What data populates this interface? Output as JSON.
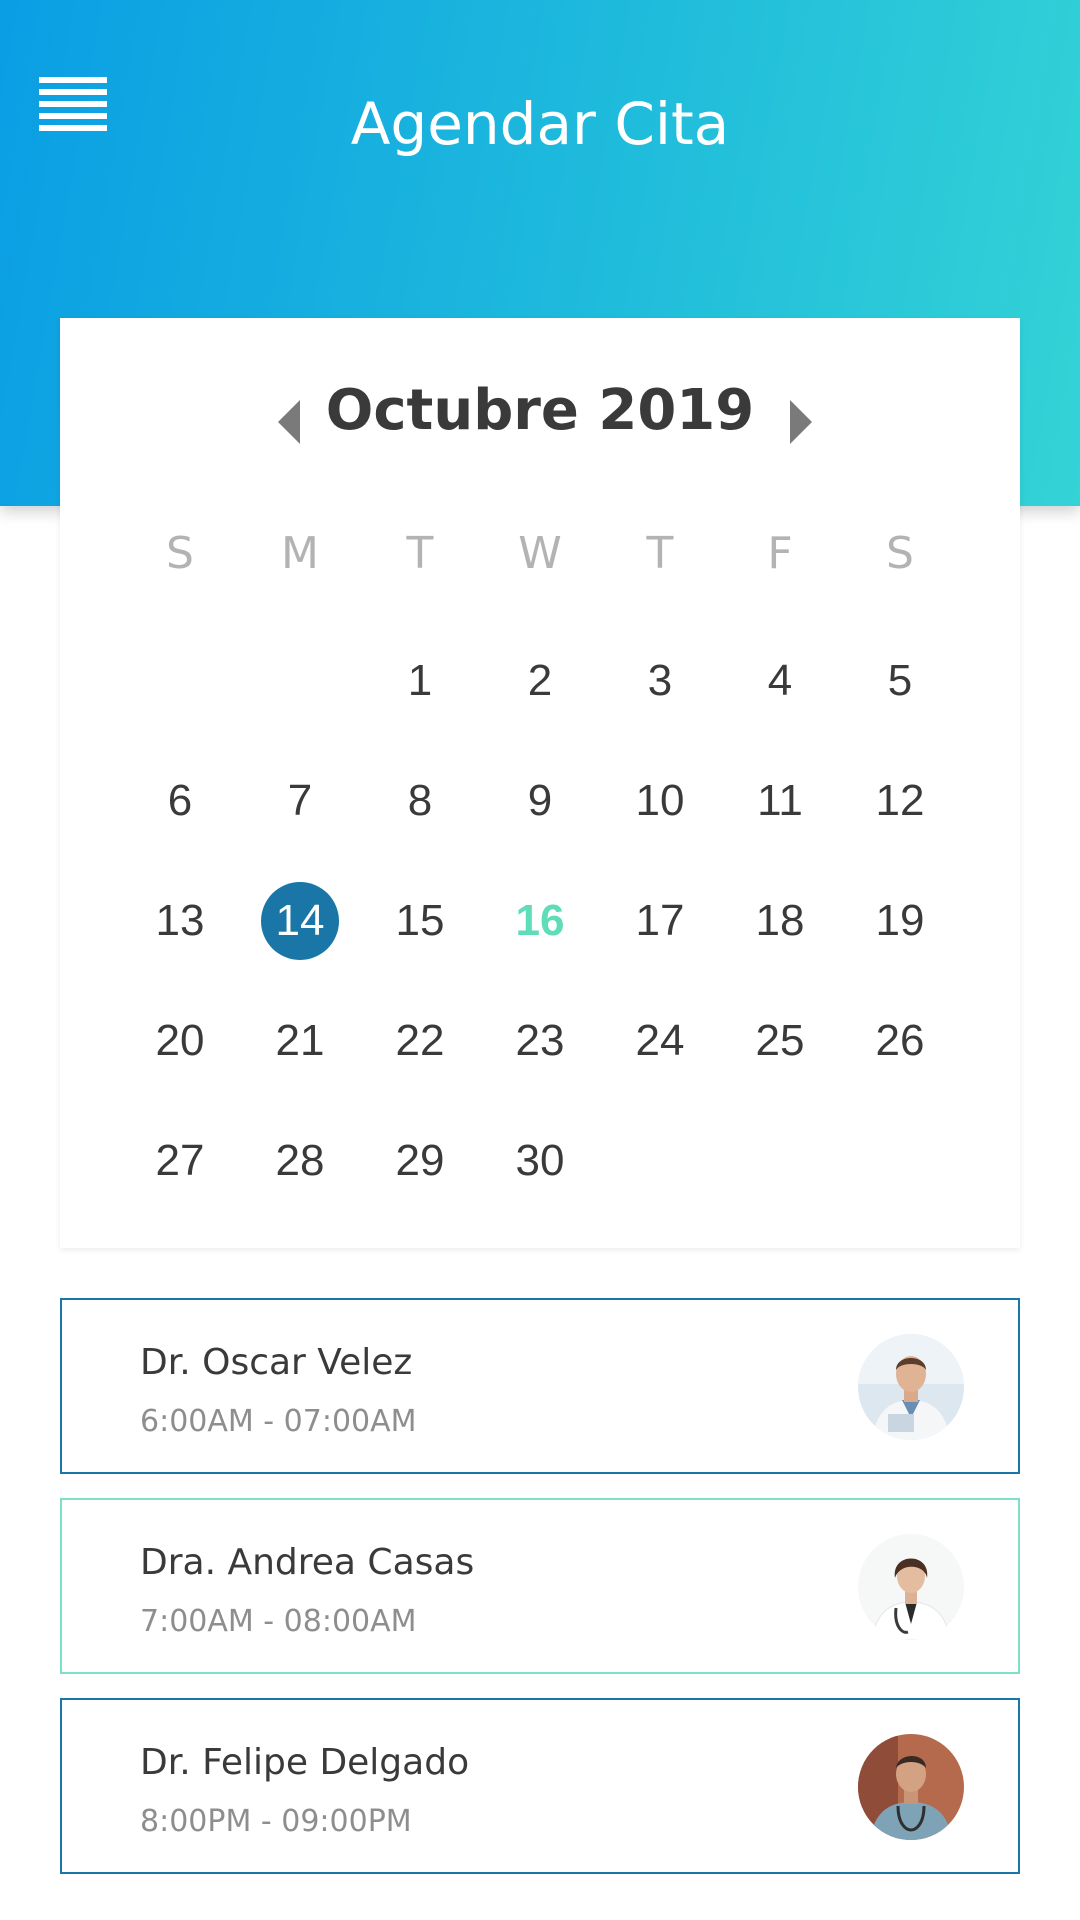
{
  "header": {
    "title": "Agendar Cita",
    "menu_icon": "menu-icon"
  },
  "calendar": {
    "month_label": "Octubre 2019",
    "prev_icon": "chevron-left-icon",
    "next_icon": "chevron-right-icon",
    "weekdays": [
      "S",
      "M",
      "T",
      "W",
      "T",
      "F",
      "S"
    ],
    "weeks": [
      [
        "",
        "",
        "1",
        "2",
        "3",
        "4",
        "5"
      ],
      [
        "6",
        "7",
        "8",
        "9",
        "10",
        "11",
        "12"
      ],
      [
        "13",
        "14",
        "15",
        "16",
        "17",
        "18",
        "19"
      ],
      [
        "20",
        "21",
        "22",
        "23",
        "24",
        "25",
        "26"
      ],
      [
        "27",
        "28",
        "29",
        "30",
        "",
        "",
        ""
      ]
    ],
    "selected_day": "14",
    "highlighted_day": "16",
    "colors": {
      "selected_bg": "#1a76a6",
      "highlight_text": "#5fdcb8",
      "header_gradient_start": "#0a9ee4",
      "header_gradient_end": "#33d3d6"
    }
  },
  "appointments": [
    {
      "name": "Dr. Oscar Velez",
      "time": "6:00AM - 07:00AM",
      "avatar": "doctor-avatar"
    },
    {
      "name": "Dra. Andrea Casas",
      "time": "7:00AM - 08:00AM",
      "avatar": "doctor-avatar"
    },
    {
      "name": "Dr. Felipe Delgado",
      "time": "8:00PM - 09:00PM",
      "avatar": "doctor-avatar"
    }
  ]
}
